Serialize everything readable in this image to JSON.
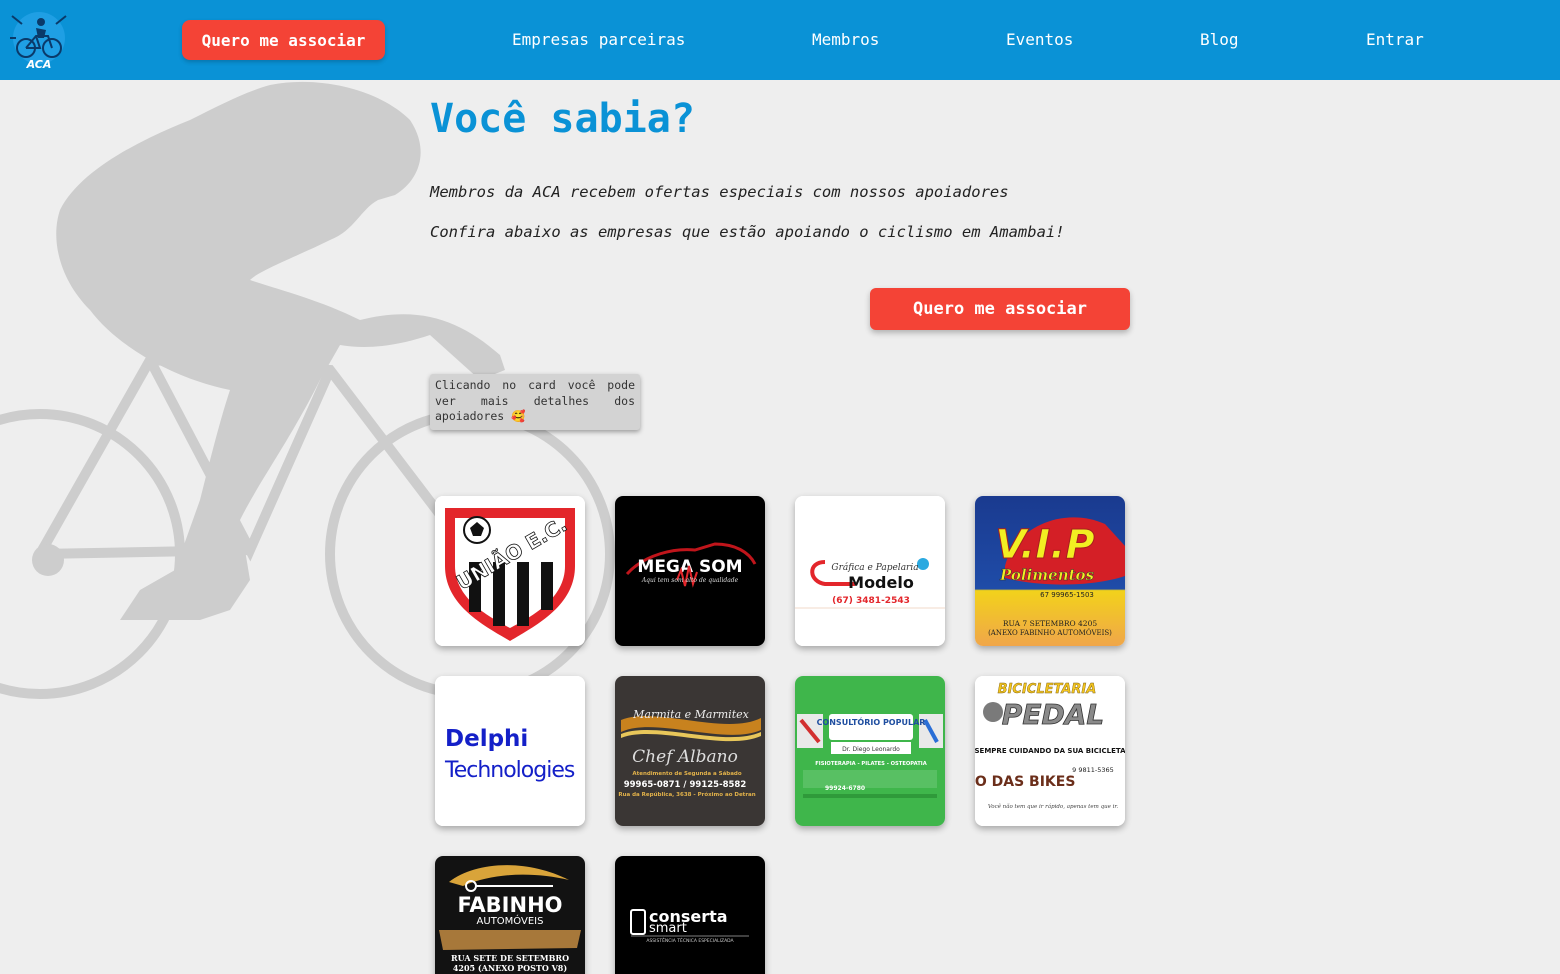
{
  "header": {
    "logo_text": "ACA",
    "cta_label": "Quero me associar",
    "nav": [
      "Empresas parceiras",
      "Membros",
      "Eventos",
      "Blog",
      "Entrar"
    ]
  },
  "main": {
    "headline": "Você sabia?",
    "line1": "Membros da ACA recebem ofertas especiais com nossos apoiadores",
    "line2": "Confira abaixo as empresas que estão apoiando o ciclismo em Amambai!",
    "cta_label": "Quero me associar",
    "hint": "Clicando no card você pode ver mais detalhes dos apoiadores 🥰"
  },
  "partners": [
    {
      "name": "União E.C.",
      "logo_text": "UNIÃO E.C."
    },
    {
      "name": "Mega Som",
      "logo_text": "MEGA SOM",
      "tagline": "Aqui tem som alto de qualidade"
    },
    {
      "name": "Gráfica e Papelaria Modelo",
      "logo_text": "Modelo",
      "subtitle": "Gráfica e Papelaria",
      "phone": "(67) 3481-2543"
    },
    {
      "name": "VIP Polimentos",
      "logo_text": "V.I.P",
      "subtitle": "Polimentos",
      "phone": "67 99965-1503",
      "address": "RUA 7 SETEMBRO 4205",
      "address2": "(ANEXO FABINHO AUTOMÓVEIS)"
    },
    {
      "name": "Delphi Technologies",
      "logo_text": "Delphi",
      "subtitle": "Technologies"
    },
    {
      "name": "Marmita e Marmitex Chef Albano",
      "logo_text": "Chef Albano",
      "subtitle": "Marmita e Marmitex",
      "phone": "99965-0871 / 99125-8582",
      "hours": "Atendimento de Segunda a Sábado",
      "address": "Rua da República, 3638 - Próximo ao Detran"
    },
    {
      "name": "Consultório Popular",
      "logo_text": "CONSULTÓRIO POPULAR",
      "subtitle": "Dr. Diego Leonardo",
      "services": "FISIOTERAPIA - PILATES - OSTEOPATIA",
      "phone": "99924-6780"
    },
    {
      "name": "Bicicletaria Pedal",
      "logo_text": "PEDAL",
      "subtitle": "BICICLETARIA",
      "tagline": "SEMPRE CUIDANDO DA SUA BICICLETA",
      "brand2": "MAGO DAS BIKES",
      "phone": "9 9811-5365",
      "quote": "Você não tem que ir rápido, apenas tem que ir."
    },
    {
      "name": "Fabinho Automóveis",
      "logo_text": "FABINHO",
      "subtitle": "AUTOMÓVEIS",
      "address": "RUA SETE DE SETEMBRO",
      "address2": "4205 (ANEXO POSTO V8)"
    },
    {
      "name": "Conserta Smart",
      "logo_text": "conserta",
      "subtitle": "smart",
      "tagline": "ASSISTÊNCIA TÉCNICA ESPECIALIZADA"
    }
  ],
  "colors": {
    "header": "#0a92d6",
    "accent": "#f44336",
    "background": "#eeeeee"
  }
}
